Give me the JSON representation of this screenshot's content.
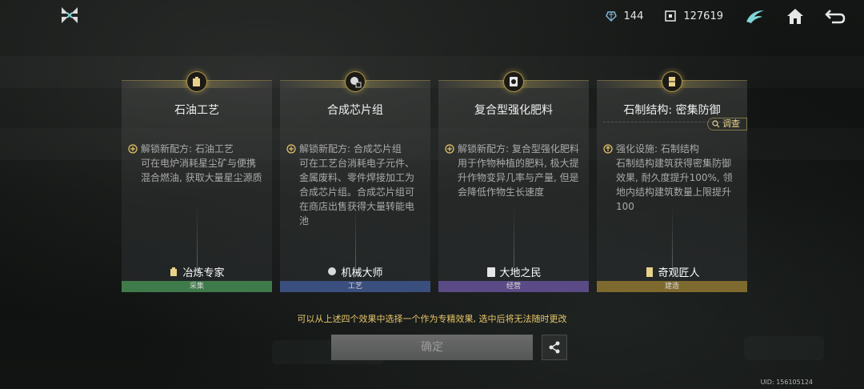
{
  "topbar": {
    "resource_1": {
      "icon": "crystal-icon",
      "value": "144"
    },
    "resource_2": {
      "icon": "chip-currency-icon",
      "value": "127619"
    },
    "buttons": [
      "faction-emblem-icon",
      "home-icon",
      "back-arrow-icon"
    ]
  },
  "cards": [
    {
      "icon": "oil-canister-icon",
      "title": "石油工艺",
      "effect_head": "解锁新配方: 石油工艺",
      "effect_body": "可在电炉消耗星尘矿与便携混合燃油, 获取大量星尘源质",
      "role": "冶炼专家",
      "category": "采集",
      "category_color": "#3f7a4a"
    },
    {
      "icon": "chip-gear-icon",
      "title": "合成芯片组",
      "effect_head": "解锁新配方: 合成芯片组",
      "effect_body": "可在工艺台消耗电子元件、金属废料、零件焊接加工为合成芯片组。合成芯片组可在商店出售获得大量转能电池",
      "role": "机械大师",
      "category": "工艺",
      "category_color": "#3b4f7e"
    },
    {
      "icon": "fertilizer-icon",
      "title": "复合型强化肥料",
      "effect_head": "解锁新配方: 复合型强化肥料",
      "effect_body": "用于作物种植的肥料, 极大提升作物变异几率与产量, 但是会降低作物生长速度",
      "role": "大地之民",
      "category": "经营",
      "category_color": "#5a4a86"
    },
    {
      "icon": "stone-block-icon",
      "title": "石制结构: 密集防御",
      "tag": "调查",
      "effect_head": "强化设施: 石制结构",
      "effect_body": "石制结构建筑获得密集防御效果, 耐久度提升100%, 领地内结构建筑数量上限提升100",
      "role": "奇观匠人",
      "category": "建造",
      "category_color": "#7e6a2e"
    }
  ],
  "hint": "可以从上述四个效果中选择一个作为专精效果, 选中后将无法随时更改",
  "confirm_label": "确定",
  "uid": "UID: 156105124",
  "colors": {
    "gold": "#e8c66a",
    "accent_cyan": "#7fd6d6"
  }
}
